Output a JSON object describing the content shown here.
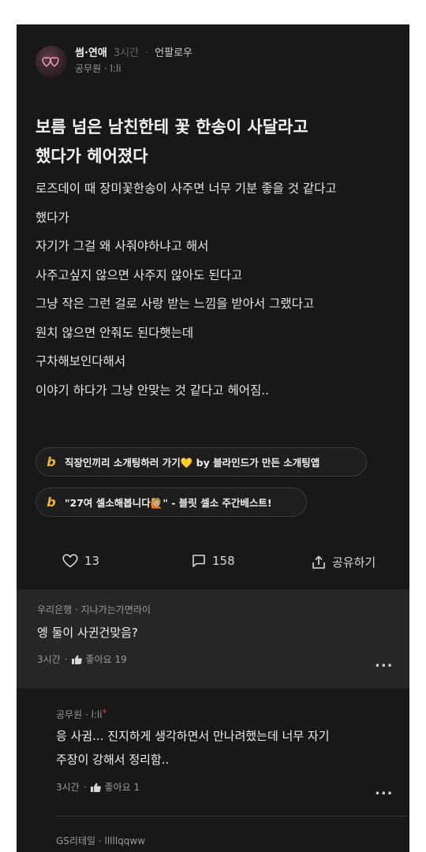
{
  "post": {
    "category": "썸·연애",
    "time": "3시간",
    "unfollow_label": "언팔로우",
    "author_company": "공무원",
    "author_name": "l:li",
    "title_lines": [
      "보름 넘은 남친한테 꽃 한송이 사달라고",
      "했다가 헤어졌다"
    ],
    "body_lines": [
      "로즈데이 때 장미꽃한송이 사주면 너무 기분 좋을 것 같다고",
      "했다가",
      "자기가 그걸 왜 사줘야하냐고 해서",
      "사주고싶지 않으면 사주지 않아도 된다고",
      "그냥 작은 그런 걸로 사랑 받는 느낌을 받아서 그랬다고",
      "원치 않으면 안줘도 된다햇는데",
      "구차해보인다해서",
      "이야기 하다가 그냥 안맞는 것 같다고 헤어짐.."
    ]
  },
  "ads": [
    {
      "logo": "b",
      "text": "직장인끼리 소개팅하러 가기💛 by 블라인드가 만든 소개팅앱"
    },
    {
      "logo": "b",
      "text": "\"27여 셀소해봅니다🙋🏼\" - 블릿 셀소 주간베스트!"
    }
  ],
  "actions": {
    "likes": "13",
    "comments": "158",
    "share_label": "공유하기"
  },
  "comments": [
    {
      "company": "우리은행",
      "nickname": "지나가는가면라이",
      "text_lines": [
        "엥 둘이 사귄건맞음?"
      ],
      "time": "3시간",
      "like_label": "좋아요 19"
    },
    {
      "company": "공무원",
      "nickname": "l:li",
      "author_mark": "*",
      "text_lines": [
        "응 사귐... 진지하게 생각하면서 만나려했는데 너무 자기",
        "주장이 강해서 정리함.."
      ],
      "time": "3시간",
      "like_label": "좋아요 1"
    },
    {
      "company": "GS리테일",
      "nickname": "lllllqqww"
    }
  ],
  "more_label": "...",
  "colors": {
    "background": "#181818",
    "comment_background": "#262626",
    "ad_logo": "#f2b233",
    "author_mark": "#e0463f"
  },
  "icons": [
    "heart-icon",
    "comment-icon",
    "share-icon",
    "thumbs-up-icon",
    "more-icon",
    "blind-b-logo"
  ]
}
